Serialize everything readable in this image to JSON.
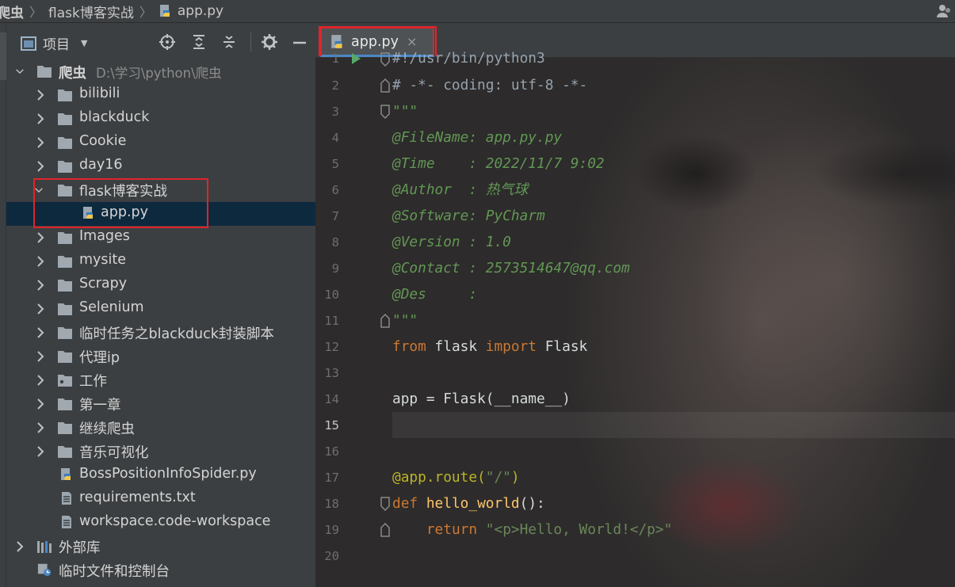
{
  "breadcrumb": {
    "items": [
      "爬虫",
      "flask博客实战",
      "app.py"
    ]
  },
  "project_panel": {
    "title": "项目",
    "dropdown_icon": "chevron-down-icon",
    "toolbar_icons": [
      "locate-icon",
      "expand-all-icon",
      "collapse-all-icon",
      "gear-icon",
      "minimize-icon"
    ]
  },
  "tree": {
    "root": {
      "name": "爬虫",
      "path": "D:\\学习\\python\\爬虫"
    },
    "items": [
      {
        "label": "bilibili",
        "type": "folder",
        "expanded": false
      },
      {
        "label": "blackduck",
        "type": "folder",
        "expanded": false
      },
      {
        "label": "Cookie",
        "type": "folder",
        "expanded": false
      },
      {
        "label": "day16",
        "type": "folder",
        "expanded": false
      },
      {
        "label": "flask博客实战",
        "type": "folder",
        "expanded": true
      },
      {
        "label": "app.py",
        "type": "python-file",
        "selected": true
      },
      {
        "label": "Images",
        "type": "folder",
        "expanded": false
      },
      {
        "label": "mysite",
        "type": "folder",
        "expanded": false
      },
      {
        "label": "Scrapy",
        "type": "folder",
        "expanded": false
      },
      {
        "label": "Selenium",
        "type": "folder",
        "expanded": false
      },
      {
        "label": "临时任务之blackduck封装脚本",
        "type": "folder",
        "expanded": false
      },
      {
        "label": "代理ip",
        "type": "folder",
        "expanded": false
      },
      {
        "label": "工作",
        "type": "folder",
        "expanded": false
      },
      {
        "label": "第一章",
        "type": "folder",
        "expanded": false
      },
      {
        "label": "继续爬虫",
        "type": "folder",
        "expanded": false
      },
      {
        "label": "音乐可视化",
        "type": "folder",
        "expanded": false
      },
      {
        "label": "BossPositionInfoSpider.py",
        "type": "python-file"
      },
      {
        "label": "requirements.txt",
        "type": "text-file"
      },
      {
        "label": "workspace.code-workspace",
        "type": "text-file"
      }
    ],
    "external_libs": "外部库",
    "scratches": "临时文件和控制台"
  },
  "editor": {
    "tab": {
      "label": "app.py",
      "close": "×"
    },
    "current_line": 15,
    "line_numbers": [
      "1",
      "2",
      "3",
      "4",
      "5",
      "6",
      "7",
      "8",
      "9",
      "10",
      "11",
      "12",
      "13",
      "14",
      "15",
      "16",
      "17",
      "18",
      "19",
      "20"
    ],
    "code": {
      "l1": "#!/usr/bin/python3",
      "l2": "# -*- coding: utf-8 -*-",
      "l3": "\"\"\"",
      "l4": "@FileName: app.py.py",
      "l5": "@Time    : 2022/11/7 9:02",
      "l6": "@Author  : 热气球",
      "l7": "@Software: PyCharm",
      "l8": "@Version : 1.0",
      "l9": "@Contact : 2573514647@qq.com",
      "l10": "@Des     :",
      "l11": "\"\"\"",
      "l12_kw1": "from",
      "l12_mod": " flask ",
      "l12_kw2": "import",
      "l12_name": " Flask",
      "l14": "app = Flask(__name__)",
      "l17_deco": "@app.route(",
      "l17_str": "\"/\"",
      "l17_close": ")",
      "l18_kw": "def",
      "l18_fn": "hello_world",
      "l18_rest": "():",
      "l19_kw": "return",
      "l19_str": "\"<p>Hello, World!</p>\""
    }
  },
  "colors": {
    "annotation_red": "#e0242b",
    "selection": "#0d293e",
    "tab_underline": "#4a88c7"
  }
}
